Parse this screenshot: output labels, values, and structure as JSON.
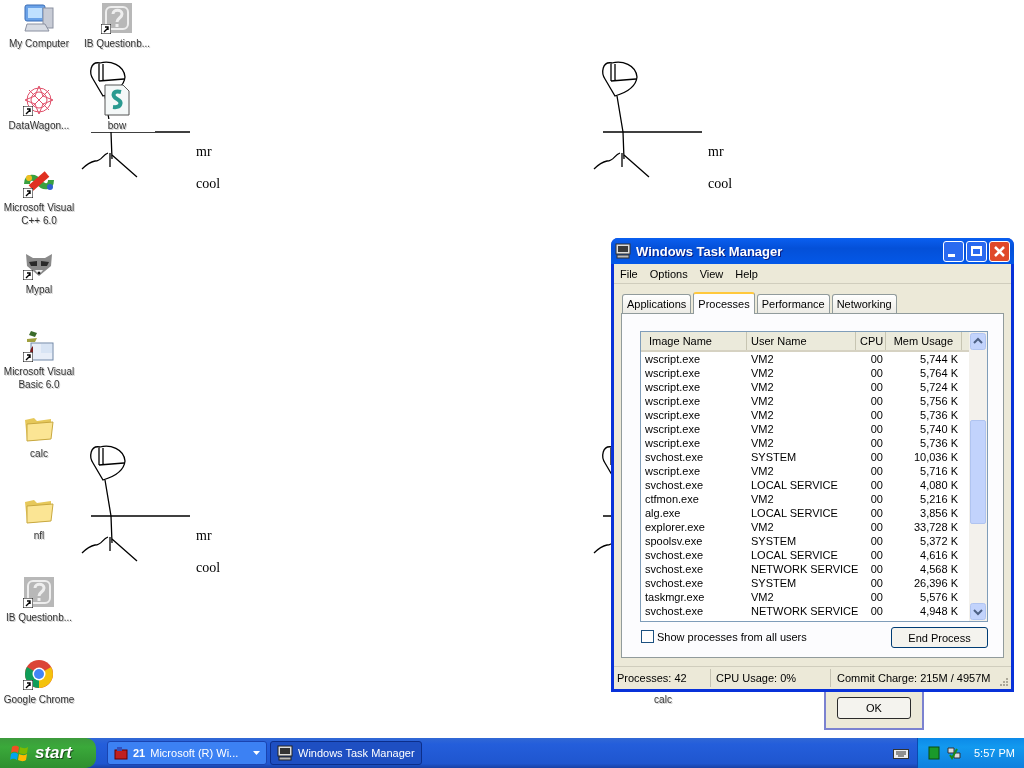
{
  "desktop": {
    "icons": [
      {
        "label": "My Computer",
        "kind": "computer",
        "shortcut": false
      },
      {
        "label": "IB Questionb...",
        "kind": "unknown",
        "shortcut": true
      },
      {
        "label": "DataWagon...",
        "kind": "flower",
        "shortcut": true
      },
      {
        "label": "bow",
        "kind": "script",
        "shortcut": false
      },
      {
        "label": "Microsoft Visual C++ 6.0",
        "kind": "vcpp",
        "shortcut": true
      },
      {
        "label": "Mypal",
        "kind": "raccoon",
        "shortcut": true
      },
      {
        "label": "Microsoft Visual Basic 6.0",
        "kind": "vb",
        "shortcut": true
      },
      {
        "label": "calc",
        "kind": "folder",
        "shortcut": false
      },
      {
        "label": "nfl",
        "kind": "folder",
        "shortcut": false
      },
      {
        "label": "IB Questionb...",
        "kind": "unknown",
        "shortcut": true
      },
      {
        "label": "Google Chrome",
        "kind": "chrome",
        "shortcut": true
      },
      {
        "label": "calc",
        "kind": "hidden",
        "shortcut": false
      }
    ],
    "wallpaper_texts": [
      {
        "line_1": "mr",
        "line_2": "cool"
      },
      {
        "line_1": "mr",
        "line_2": "cool"
      },
      {
        "line_1": "mr",
        "line_2": "cool"
      }
    ]
  },
  "dialog": {
    "button": "OK"
  },
  "task_manager": {
    "title": "Windows Task Manager",
    "menu": [
      "File",
      "Options",
      "View",
      "Help"
    ],
    "tabs": [
      {
        "label": "Applications",
        "selected": false
      },
      {
        "label": "Processes",
        "selected": true
      },
      {
        "label": "Performance",
        "selected": false
      },
      {
        "label": "Networking",
        "selected": false
      }
    ],
    "columns": [
      "Image Name",
      "User Name",
      "CPU",
      "Mem Usage"
    ],
    "rows": [
      [
        "wscript.exe",
        "VM2",
        "00",
        "5,744 K"
      ],
      [
        "wscript.exe",
        "VM2",
        "00",
        "5,764 K"
      ],
      [
        "wscript.exe",
        "VM2",
        "00",
        "5,724 K"
      ],
      [
        "wscript.exe",
        "VM2",
        "00",
        "5,756 K"
      ],
      [
        "wscript.exe",
        "VM2",
        "00",
        "5,736 K"
      ],
      [
        "wscript.exe",
        "VM2",
        "00",
        "5,740 K"
      ],
      [
        "wscript.exe",
        "VM2",
        "00",
        "5,736 K"
      ],
      [
        "svchost.exe",
        "SYSTEM",
        "00",
        "10,036 K"
      ],
      [
        "wscript.exe",
        "VM2",
        "00",
        "5,716 K"
      ],
      [
        "svchost.exe",
        "LOCAL SERVICE",
        "00",
        "4,080 K"
      ],
      [
        "ctfmon.exe",
        "VM2",
        "00",
        "5,216 K"
      ],
      [
        "alg.exe",
        "LOCAL SERVICE",
        "00",
        "3,856 K"
      ],
      [
        "explorer.exe",
        "VM2",
        "00",
        "33,728 K"
      ],
      [
        "spoolsv.exe",
        "SYSTEM",
        "00",
        "5,372 K"
      ],
      [
        "svchost.exe",
        "LOCAL SERVICE",
        "00",
        "4,616 K"
      ],
      [
        "svchost.exe",
        "NETWORK SERVICE",
        "00",
        "4,568 K"
      ],
      [
        "svchost.exe",
        "SYSTEM",
        "00",
        "26,396 K"
      ],
      [
        "taskmgr.exe",
        "VM2",
        "00",
        "5,576 K"
      ],
      [
        "svchost.exe",
        "NETWORK SERVICE",
        "00",
        "4,948 K"
      ]
    ],
    "show_all_users": {
      "label": "Show processes from all users",
      "checked": false
    },
    "end_button": "End Process",
    "status": [
      "Processes: 42",
      "CPU Usage: 0%",
      "Commit Charge: 215M / 4957M"
    ]
  },
  "taskbar": {
    "start": "start",
    "buttons": [
      {
        "count": "21",
        "label": "Microsoft (R) Wi...",
        "kind": "group",
        "selected": false
      },
      {
        "label": "Windows Task Manager",
        "kind": "window",
        "selected": true
      }
    ],
    "clock": "5:57 PM"
  }
}
